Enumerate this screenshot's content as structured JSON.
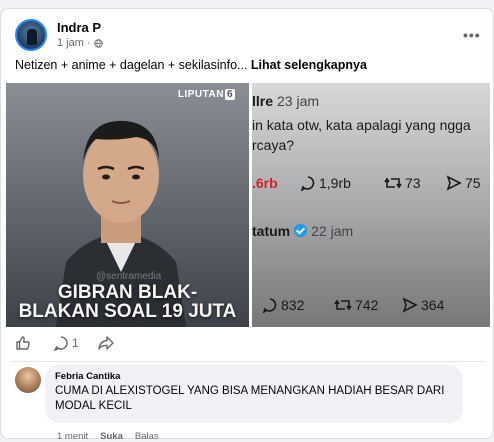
{
  "post": {
    "author": "Indra P",
    "time": "1 jam",
    "caption": "Netizen + anime + dagelan + sekilasinfo... ",
    "see_more": "Lihat selengkapnya",
    "more_label": "•••"
  },
  "media": {
    "left": {
      "brand": "LIPUTAN",
      "brand_num": "6",
      "watermark": "@sentramedia",
      "headline_1": "GIBRAN BLAK-",
      "headline_2": "BLAKAN SOAL 19 JUTA"
    },
    "right": {
      "tweet1_user": "llre",
      "tweet1_time": "23 jam",
      "tweet1_line1": "in kata otw, kata apalagi yang ngga",
      "tweet1_line2": "rcaya?",
      "tweet1_likes": ".6rb",
      "tweet1_replies": "1,9rb",
      "tweet1_retweets": "73",
      "tweet1_shares": "75",
      "tweet2_user": "tatum",
      "tweet2_time": "22 jam",
      "tweet2_replies": "832",
      "tweet2_retweets": "742",
      "tweet2_shares": "364"
    }
  },
  "actions": {
    "comment_count": "1"
  },
  "comment": {
    "author": "Febria Cantika",
    "text_line1": "CUMA DI ALEXISTOGEL YANG BISA MENANGKAN HADIAH BESAR DARI",
    "text_line2": "MODAL KECIL",
    "time": "1 menit",
    "like": "Suka",
    "reply": "Balas"
  },
  "colors": {
    "link_blue": "#1877f2",
    "muted_text": "#65676b",
    "bubble_bg": "#f0f2f5",
    "verified_blue": "#1d9bf0"
  },
  "icons": [
    "globe-icon",
    "more-options-icon",
    "like-icon",
    "comment-icon",
    "share-icon",
    "verified-icon",
    "reply-icon",
    "retweet-icon",
    "send-icon"
  ]
}
